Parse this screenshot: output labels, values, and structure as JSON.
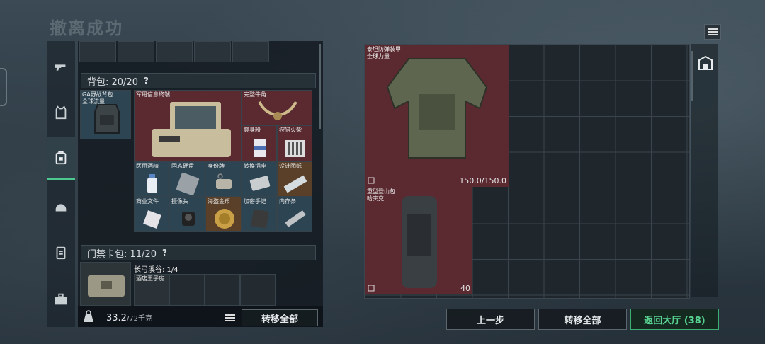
{
  "title": "撤离成功",
  "backpack": {
    "label": "背包: 20/20",
    "help": "?",
    "items": [
      {
        "label": "GA野战背包\n全球流量"
      },
      {
        "label": "军用信息终端"
      },
      {
        "label": "完整牛角"
      },
      {
        "label": "爽身粉"
      },
      {
        "label": "狩猎火柴"
      },
      {
        "label": "医用酒精"
      },
      {
        "label": "固态硬盘"
      },
      {
        "label": "身份牌"
      },
      {
        "label": "转换插座"
      },
      {
        "label": "设计图纸"
      },
      {
        "label": "商业文件"
      },
      {
        "label": "摄像头"
      },
      {
        "label": "海盗金币"
      },
      {
        "label": "加密手记"
      },
      {
        "label": "内存条"
      }
    ]
  },
  "keycard": {
    "label": "门禁卡包: 11/20",
    "help": "?",
    "location": "长弓溪谷: 1/4",
    "slot_label": "酒店王子房"
  },
  "weight": {
    "value": "33.2",
    "max": "/72千克"
  },
  "left_transfer_all": "转移全部",
  "right_items": [
    {
      "label": "泰坦防弹装甲\n全球力量",
      "value": "150.0/150.0"
    },
    {
      "label": "重型登山包\n哈夫克",
      "value": "40"
    }
  ],
  "buttons": {
    "back": "上一步",
    "transfer_all": "转移全部",
    "return_lobby": "返回大厅 (38)"
  },
  "colors": {
    "accent": "#58d492",
    "red_cell": "#5a2a30",
    "blue_cell": "#2d4452"
  }
}
